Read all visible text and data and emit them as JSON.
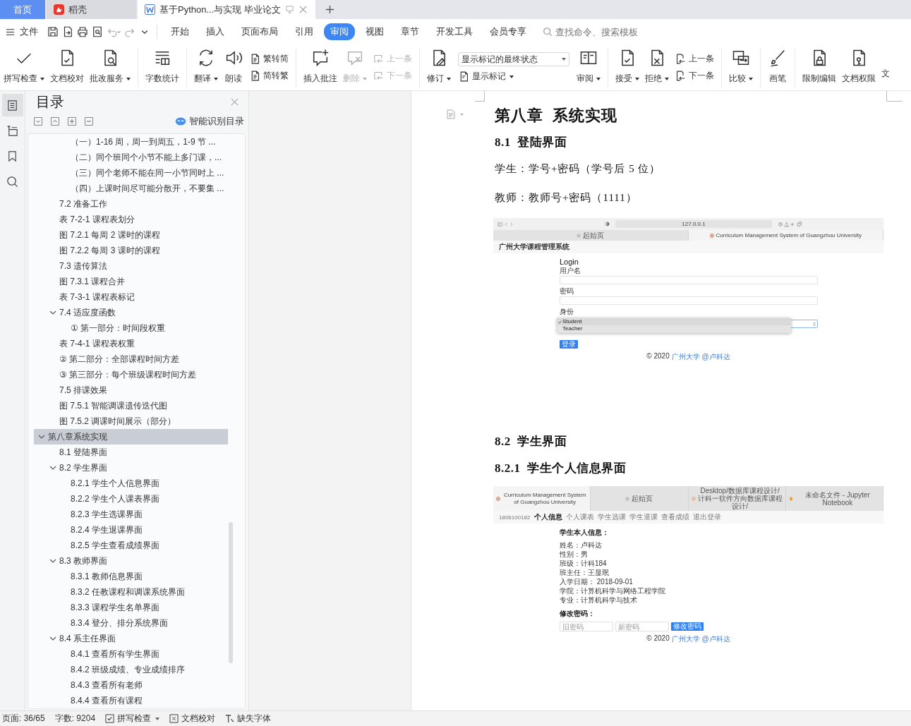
{
  "title_bar": {
    "tabs": [
      {
        "kind": "home",
        "label": "首页",
        "selected": false
      },
      {
        "kind": "app",
        "label": "稻壳",
        "selected": false
      },
      {
        "kind": "doc",
        "label": "基于Python...与实现 毕业论文",
        "selected": true
      }
    ]
  },
  "menu": {
    "file": "文件",
    "tabs": [
      {
        "label": "开始",
        "selected": false
      },
      {
        "label": "插入",
        "selected": false
      },
      {
        "label": "页面布局",
        "selected": false
      },
      {
        "label": "引用",
        "selected": false
      },
      {
        "label": "审阅",
        "selected": true
      },
      {
        "label": "视图",
        "selected": false
      },
      {
        "label": "章节",
        "selected": false
      },
      {
        "label": "开发工具",
        "selected": false
      },
      {
        "label": "会员专享",
        "selected": false
      }
    ],
    "search": {
      "placeholder": "查找命令、搜索模板"
    }
  },
  "ribbon": {
    "groups": [
      [
        {
          "kind": "large",
          "label": "拼写检查",
          "dropdown": true,
          "disabled": false
        },
        {
          "kind": "large",
          "label": "文档校对",
          "dropdown": false,
          "disabled": false
        },
        {
          "kind": "large",
          "label": "批改服务",
          "dropdown": true,
          "disabled": false
        }
      ],
      [
        {
          "kind": "large",
          "label": "字数统计",
          "dropdown": false,
          "disabled": false
        }
      ],
      [
        {
          "kind": "large",
          "label": "翻译",
          "dropdown": true,
          "disabled": false
        },
        {
          "kind": "large",
          "label": "朗读",
          "dropdown": false,
          "disabled": false
        },
        {
          "kind": "pair",
          "items": [
            {
              "label": "繁转简",
              "disabled": false
            },
            {
              "label": "简转繁",
              "disabled": false
            }
          ]
        }
      ],
      [
        {
          "kind": "large",
          "label": "插入批注",
          "dropdown": false,
          "disabled": false
        },
        {
          "kind": "large",
          "label": "删除",
          "dropdown": true,
          "disabled": true
        },
        {
          "kind": "pair",
          "items": [
            {
              "label": "上一条",
              "disabled": true
            },
            {
              "label": "下一条",
              "disabled": true
            }
          ]
        }
      ],
      [
        {
          "kind": "large",
          "label": "修订",
          "dropdown": true,
          "disabled": false
        },
        {
          "kind": "status",
          "select": {
            "value": "显示标记的最终状态"
          },
          "item": {
            "label": "显示标记",
            "dropdown": true
          }
        },
        {
          "kind": "large",
          "label": "审阅",
          "dropdown": true,
          "disabled": false
        }
      ],
      [
        {
          "kind": "large",
          "label": "接受",
          "dropdown": true,
          "disabled": false
        },
        {
          "kind": "large",
          "label": "拒绝",
          "dropdown": true,
          "disabled": false
        },
        {
          "kind": "pair",
          "items": [
            {
              "label": "上一条",
              "disabled": false
            },
            {
              "label": "下一条",
              "disabled": false
            }
          ]
        }
      ],
      [
        {
          "kind": "large",
          "label": "比较",
          "dropdown": true,
          "disabled": false
        }
      ],
      [
        {
          "kind": "large",
          "label": "画笔",
          "dropdown": false,
          "disabled": false
        }
      ],
      [
        {
          "kind": "large",
          "label": "限制编辑",
          "dropdown": false,
          "disabled": false
        },
        {
          "kind": "large",
          "label": "文档权限",
          "dropdown": false,
          "disabled": false
        },
        {
          "kind": "clipped",
          "label": "文"
        }
      ]
    ]
  },
  "side_strip": [
    {
      "selected": true
    },
    {
      "selected": false
    },
    {
      "selected": false
    },
    {
      "selected": false
    }
  ],
  "toc": {
    "title": "目录",
    "smart_button": "智能识别目录",
    "items": [
      {
        "children": [
          {
            "children": [
              {
                "label": "（一）1-16 周，周一到周五，1-9 节 ...",
                "selected": false
              },
              {
                "label": "（二）同个班同个小节不能上多门课，...",
                "selected": false
              },
              {
                "label": "（三）同个老师不能在同一小节同时上 ...",
                "selected": false
              },
              {
                "label": "（四）上课时间尽可能分散开，不要集 ...",
                "selected": false
              }
            ]
          },
          {
            "label": "7.2 准备工作",
            "selected": false
          },
          {
            "label": "表 7-2-1 课程表划分",
            "selected": false
          },
          {
            "label": "图 7.2.1 每周 2 课时的课程",
            "selected": false
          },
          {
            "label": "图 7.2.2 每周 3 课时的课程",
            "selected": false
          },
          {
            "label": "7.3 遗传算法",
            "selected": false
          },
          {
            "label": "图 7.3.1 课程合并",
            "selected": false
          },
          {
            "label": "表 7-3-1 课程表标记",
            "selected": false
          },
          {
            "label": "7.4 适应度函数",
            "selected": false,
            "expanded": true,
            "children": [
              {
                "label": "① 第一部分：时间段权重",
                "selected": false
              }
            ]
          },
          {
            "label": "表 7-4-1 课程表权重",
            "selected": false
          },
          {
            "label": "② 第二部分：全部课程时间方差",
            "selected": false
          },
          {
            "label": "③ 第三部分：每个班级课程时间方差",
            "selected": false
          },
          {
            "label": "7.5 排课效果",
            "selected": false
          },
          {
            "label": "图 7.5.1 智能调课遗传迭代图",
            "selected": false
          },
          {
            "label": "图 7.5.2 调课时间展示（部分）",
            "selected": false
          }
        ]
      },
      {
        "label": "第八章系统实现",
        "selected": true,
        "expanded": true,
        "children": [
          {
            "label": "8.1 登陆界面",
            "selected": false
          },
          {
            "label": "8.2 学生界面",
            "selected": false,
            "expanded": true,
            "children": [
              {
                "label": "8.2.1 学生个人信息界面",
                "selected": false
              },
              {
                "label": "8.2.2 学生个人课表界面",
                "selected": false
              },
              {
                "label": "8.2.3 学生选课界面",
                "selected": false
              },
              {
                "label": "8.2.4 学生退课界面",
                "selected": false
              },
              {
                "label": "8.2.5 学生查看成绩界面",
                "selected": false
              }
            ]
          },
          {
            "label": "8.3 教师界面",
            "selected": false,
            "expanded": true,
            "children": [
              {
                "label": "8.3.1 教师信息界面",
                "selected": false
              },
              {
                "label": "8.3.2 任教课程和调课系统界面",
                "selected": false
              },
              {
                "label": "8.3.3 课程学生名单界面",
                "selected": false
              },
              {
                "label": "8.3.4 登分、排分系统界面",
                "selected": false
              }
            ]
          },
          {
            "label": "8.4 系主任界面",
            "selected": false,
            "expanded": true,
            "children": [
              {
                "label": "8.4.1 查看所有学生界面",
                "selected": false
              },
              {
                "label": "8.4.2 班级成绩、专业成绩排序",
                "selected": false
              },
              {
                "label": "8.4.3 查看所有老师",
                "selected": false
              },
              {
                "label": "8.4.4 查看所有课程",
                "selected": false
              }
            ]
          }
        ]
      }
    ]
  },
  "document": {
    "blocks": [
      {
        "kind": "chapter",
        "text": "第八章  系统实现"
      },
      {
        "kind": "heading",
        "text": "8.1  登陆界面"
      },
      {
        "kind": "paragraph",
        "text": "学生：学号+密码（学号后 5 位）"
      },
      {
        "kind": "paragraph",
        "text": "教师：教师号+密码（1111）"
      },
      {
        "kind": "login_screenshot",
        "address": "127.0.0.1",
        "tabs": [
          {
            "label": "起始页",
            "selected": false
          },
          {
            "label": "Curriculum Management System of Guangzhou University",
            "selected": true
          }
        ],
        "site_title": "广州大学课程管理系统",
        "heading": "Login",
        "fields": [
          {
            "label": "用户名"
          },
          {
            "label": "密码"
          }
        ],
        "role_label": "身份",
        "role_options": [
          {
            "label": "Student",
            "selected": true
          },
          {
            "label": "Teacher",
            "selected": false
          }
        ],
        "submit": "登录",
        "footer_text": "© 2020",
        "footer_link": "广州大学 @卢科达"
      },
      {
        "kind": "heading",
        "text": "8.2  学生界面"
      },
      {
        "kind": "heading",
        "text": "8.2.1  学生个人信息界面"
      },
      {
        "kind": "profile_screenshot",
        "tabs": [
          {
            "label": "Curriculum Management System of Guangzhou University",
            "selected": true
          },
          {
            "label": "起始页",
            "selected": false
          },
          {
            "label": "Desktop/数据库课程设计/计科一软件方向数据库课程设计/",
            "selected": false
          },
          {
            "label": "未命名文件 - Jupyter Notebook",
            "selected": false
          }
        ],
        "user_id": "1806100182",
        "nav": [
          {
            "label": "个人信息",
            "selected": true
          },
          {
            "label": "个人课表",
            "selected": false
          },
          {
            "label": "学生选课",
            "selected": false
          },
          {
            "label": "学生退课",
            "selected": false
          },
          {
            "label": "查看成绩",
            "selected": false
          },
          {
            "label": "退出登录",
            "selected": false
          }
        ],
        "heading": "学生本人信息：",
        "info": [
          "姓名：卢科达",
          "性别：男",
          "班级：计科184",
          "班主任：王显珉",
          "入学日期： 2018-09-01",
          "学院：计算机科学与网络工程学院",
          "专业：计算机科学与技术"
        ],
        "password_heading": "修改密码：",
        "password_fields": [
          {
            "placeholder": "旧密码"
          },
          {
            "placeholder": "新密码"
          }
        ],
        "submit": "修改密码",
        "footer_text": "© 2020",
        "footer_link": "广州大学 @卢科达"
      }
    ]
  },
  "status_bar": {
    "page": "页面: 36/65",
    "words": "字数: 9204",
    "spell_check": {
      "label": "拼写检查",
      "checked": true
    },
    "proofread": "文档校对",
    "missing_font": "缺失字体"
  }
}
